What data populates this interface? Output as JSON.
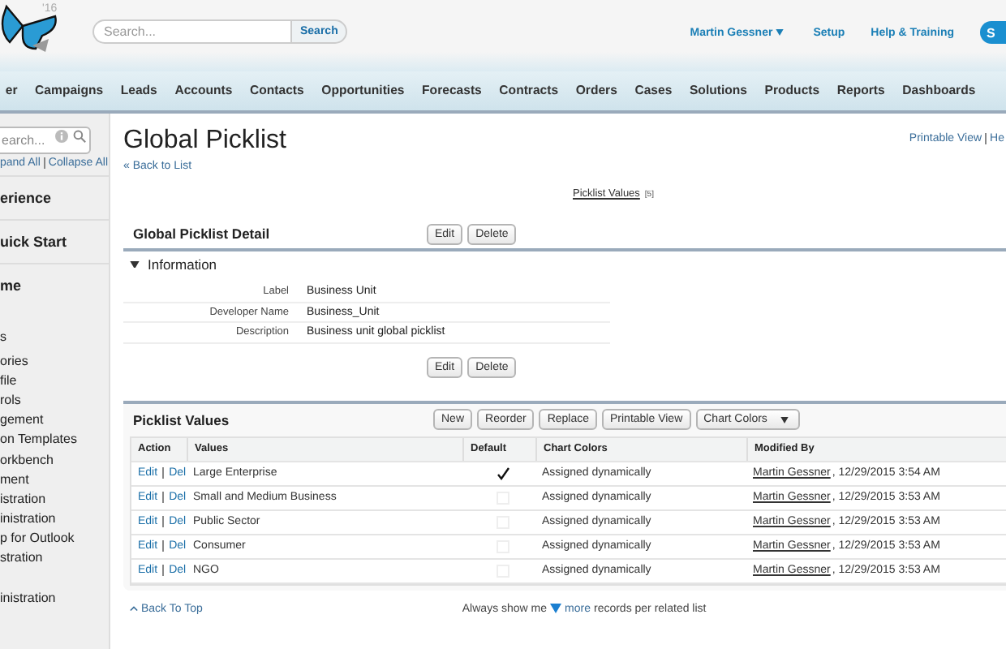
{
  "header": {
    "logo_badge": "'16",
    "search": {
      "placeholder": "Search...",
      "button": "Search"
    },
    "user_menu": "Martin Gessner",
    "links": [
      "Setup",
      "Help & Training"
    ],
    "cut_button": "S"
  },
  "tabs": [
    {
      "label": "er",
      "selected": false
    },
    {
      "label": "Campaigns",
      "selected": false
    },
    {
      "label": "Leads",
      "selected": false
    },
    {
      "label": "Accounts",
      "selected": false
    },
    {
      "label": "Contacts",
      "selected": false
    },
    {
      "label": "Opportunities",
      "selected": false
    },
    {
      "label": "Forecasts",
      "selected": false
    },
    {
      "label": "Contracts",
      "selected": false
    },
    {
      "label": "Orders",
      "selected": false
    },
    {
      "label": "Cases",
      "selected": false
    },
    {
      "label": "Solutions",
      "selected": false
    },
    {
      "label": "Products",
      "selected": false
    },
    {
      "label": "Reports",
      "selected": false
    },
    {
      "label": "Dashboards",
      "selected": false
    }
  ],
  "sidebar": {
    "search": {
      "placeholder": "earch..."
    },
    "expand": "pand All",
    "collapse": "Collapse All",
    "items": [
      {
        "label": "erience",
        "kind": "section"
      },
      {
        "label": "uick Start",
        "kind": "section"
      },
      {
        "label": "me",
        "kind": "section"
      },
      {
        "label": "s",
        "kind": "heading"
      },
      {
        "label": "ories",
        "kind": "link"
      },
      {
        "label": "file",
        "kind": "link"
      },
      {
        "label": "rols",
        "kind": "link"
      },
      {
        "label": "gement",
        "kind": "link"
      },
      {
        "label": "on Templates",
        "kind": "link"
      },
      {
        "label": "orkbench",
        "kind": "link"
      },
      {
        "label": "ment",
        "kind": "link"
      },
      {
        "label": "istration",
        "kind": "link"
      },
      {
        "label": "inistration",
        "kind": "link"
      },
      {
        "label": "p for Outlook",
        "kind": "link"
      },
      {
        "label": "stration",
        "kind": "link"
      },
      {
        "label": "inistration",
        "kind": "heading"
      }
    ]
  },
  "page": {
    "title": "Global Picklist",
    "back_link": "« Back to List",
    "top_links": [
      "Printable View",
      "He"
    ],
    "related_link": "Picklist Values",
    "related_count": "[5]"
  },
  "detail": {
    "title": "Global Picklist Detail",
    "buttons": [
      "Edit",
      "Delete"
    ],
    "section": "Information",
    "expanded": true,
    "fields": [
      {
        "label": "Label",
        "value": "Business Unit"
      },
      {
        "label": "Developer Name",
        "value": "Business_Unit"
      },
      {
        "label": "Description",
        "value": "Business unit global picklist"
      }
    ],
    "bottom_buttons": [
      "Edit",
      "Delete"
    ]
  },
  "picklist": {
    "title": "Picklist Values",
    "buttons": [
      "New",
      "Reorder",
      "Replace",
      "Printable View"
    ],
    "menu_button": "Chart Colors",
    "columns": [
      "Action",
      "Values",
      "Default",
      "Chart Colors",
      "Modified By"
    ],
    "rows": [
      {
        "edit": "Edit",
        "del": "Del",
        "value": "Large Enterprise",
        "default": true,
        "chart_color": "Assigned dynamically",
        "modified_by": "Martin Gessner",
        "modified_at": ", 12/29/2015 3:54 AM"
      },
      {
        "edit": "Edit",
        "del": "Del",
        "value": "Small and Medium Business",
        "default": false,
        "chart_color": "Assigned dynamically",
        "modified_by": "Martin Gessner",
        "modified_at": ", 12/29/2015 3:53 AM"
      },
      {
        "edit": "Edit",
        "del": "Del",
        "value": "Public Sector",
        "default": false,
        "chart_color": "Assigned dynamically",
        "modified_by": "Martin Gessner",
        "modified_at": ", 12/29/2015 3:53 AM"
      },
      {
        "edit": "Edit",
        "del": "Del",
        "value": "Consumer",
        "default": false,
        "chart_color": "Assigned dynamically",
        "modified_by": "Martin Gessner",
        "modified_at": ", 12/29/2015 3:53 AM"
      },
      {
        "edit": "Edit",
        "del": "Del",
        "value": "NGO",
        "default": false,
        "chart_color": "Assigned dynamically",
        "modified_by": "Martin Gessner",
        "modified_at": ", 12/29/2015 3:53 AM"
      }
    ]
  },
  "footer": {
    "back_to_top": "Back To Top",
    "show_before": "Always show me",
    "more": "more",
    "show_after": "records per related list"
  }
}
